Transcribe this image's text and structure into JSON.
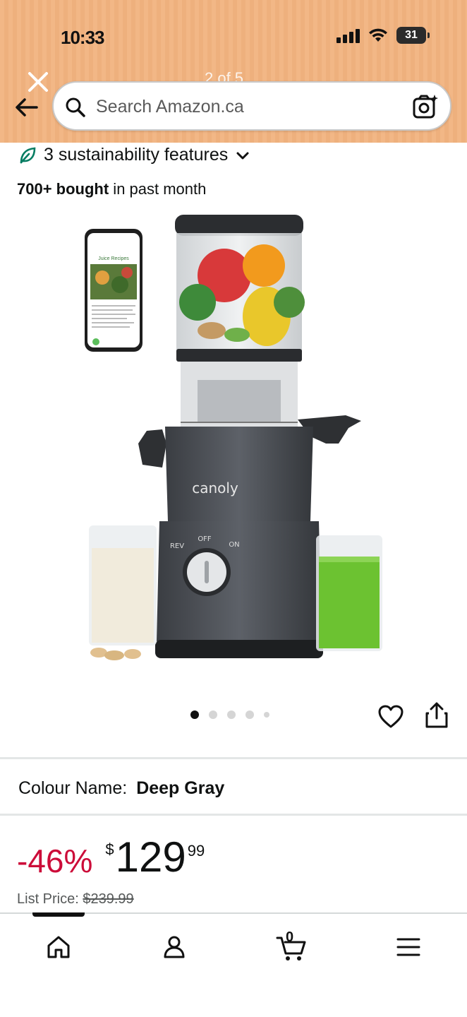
{
  "status_bar": {
    "time": "10:33",
    "battery": "31"
  },
  "viewer": {
    "counter": "2 of 5"
  },
  "search": {
    "placeholder": "Search Amazon.ca"
  },
  "product": {
    "sustainability": "3 sustainability features",
    "bought_count": "700+ bought",
    "bought_suffix": " in past month",
    "colour_label": "Colour Name:",
    "colour_value": "Deep Gray",
    "discount": "-46%",
    "currency": "$",
    "price_whole": "129",
    "price_fraction": "99",
    "list_price_label": "List Price:",
    "list_price_value": "$239.99",
    "image": {
      "brand_text": "canoly",
      "knob_labels": [
        "REV",
        "OFF",
        "ON"
      ],
      "phone_heading": "Juice Recipes"
    }
  },
  "carousel": {
    "dot_count": 5,
    "active_index": 0
  },
  "bottom_nav": {
    "items": [
      "home-icon",
      "account-icon",
      "cart-icon",
      "menu-icon"
    ],
    "cart_count": "0"
  },
  "colors": {
    "header": "#f2b786",
    "discount": "#cc0c39",
    "sustain_green": "#067d62"
  }
}
